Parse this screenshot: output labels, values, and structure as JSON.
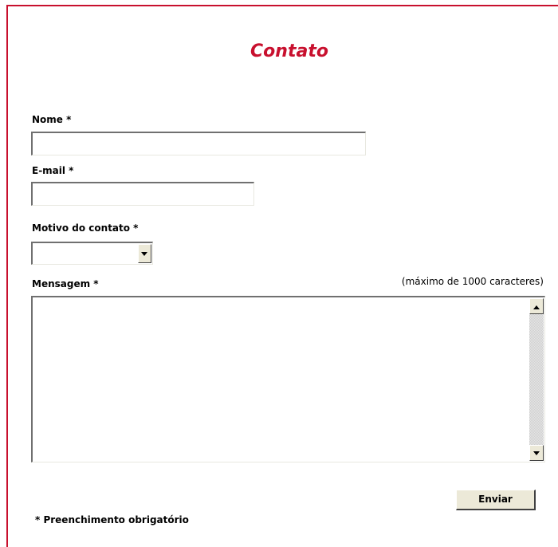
{
  "form": {
    "title": "Contato",
    "name_label": "Nome *",
    "name_value": "",
    "email_label": "E-mail *",
    "email_value": "",
    "reason_label": "Motivo do contato *",
    "reason_value": "",
    "message_label": "Mensagem *",
    "message_hint": "(máximo de 1000 caracteres)",
    "message_value": "",
    "submit_label": "Enviar",
    "required_note": "* Preenchimento obrigatório"
  },
  "colors": {
    "accent": "#c8102e",
    "button_face": "#ece9d8"
  },
  "icons": {
    "dropdown": "chevron-down-icon",
    "scroll_up": "scroll-up-arrow-icon",
    "scroll_down": "scroll-down-arrow-icon"
  }
}
